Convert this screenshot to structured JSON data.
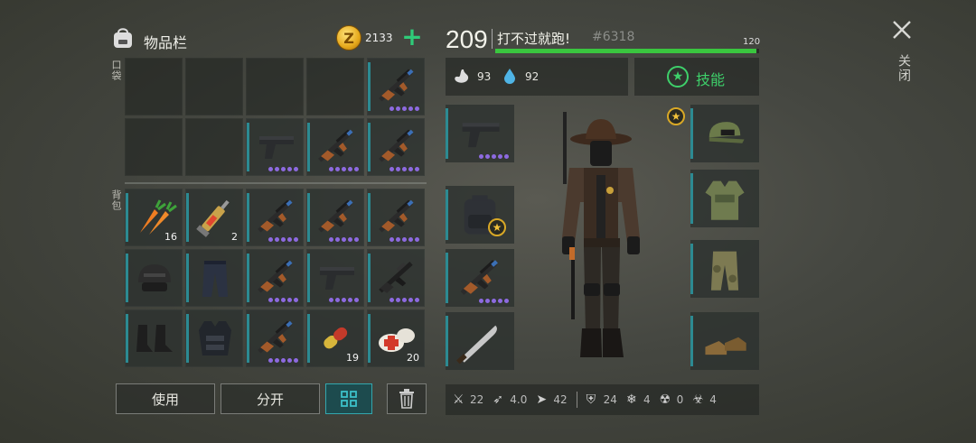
{
  "inventory": {
    "title": "物品栏",
    "coins": "2133",
    "coin_symbol": "Z",
    "add_label": "+",
    "pocket_label": "口袋",
    "backpack_label": "背包",
    "pocket": [
      {
        "item": "",
        "count": "",
        "dots": 0
      },
      {
        "item": "",
        "count": "",
        "dots": 0
      },
      {
        "item": "",
        "count": "",
        "dots": 0
      },
      {
        "item": "",
        "count": "",
        "dots": 0
      },
      {
        "item": "assault-rifle",
        "count": "",
        "dots": 5
      },
      {
        "item": "",
        "count": "",
        "dots": 0
      },
      {
        "item": "",
        "count": "",
        "dots": 0
      },
      {
        "item": "pistol",
        "count": "",
        "dots": 5
      },
      {
        "item": "assault-rifle",
        "count": "",
        "dots": 5
      },
      {
        "item": "assault-rifle",
        "count": "",
        "dots": 5
      }
    ],
    "backpack": [
      {
        "item": "carrots",
        "count": "16",
        "dots": 0
      },
      {
        "item": "syringe",
        "count": "2",
        "dots": 0
      },
      {
        "item": "assault-rifle",
        "count": "",
        "dots": 5
      },
      {
        "item": "assault-rifle",
        "count": "",
        "dots": 5
      },
      {
        "item": "assault-rifle",
        "count": "",
        "dots": 5
      },
      {
        "item": "helmet",
        "count": "",
        "dots": 0
      },
      {
        "item": "tactical-pants",
        "count": "",
        "dots": 0
      },
      {
        "item": "assault-rifle",
        "count": "",
        "dots": 5
      },
      {
        "item": "pistol",
        "count": "",
        "dots": 5
      },
      {
        "item": "rifle-dark",
        "count": "",
        "dots": 5
      },
      {
        "item": "boots",
        "count": "",
        "dots": 0
      },
      {
        "item": "armor-vest",
        "count": "",
        "dots": 0
      },
      {
        "item": "assault-rifle",
        "count": "",
        "dots": 5
      },
      {
        "item": "pills",
        "count": "19",
        "dots": 0
      },
      {
        "item": "bandage",
        "count": "20",
        "dots": 0
      }
    ],
    "buttons": {
      "use": "使用",
      "split": "分开"
    }
  },
  "player": {
    "level": "209",
    "name": "打不过就跑!",
    "id": "#6318",
    "xp_max": "120",
    "xp_fraction": 0.99,
    "hunger": "93",
    "thirst": "92",
    "skills_label": "技能"
  },
  "equipment": {
    "left": [
      "pistol",
      "backpack",
      "assault-rifle",
      "machete"
    ],
    "right": [
      "cap",
      "camo-jacket",
      "camo-pants",
      "shoes"
    ]
  },
  "stats": [
    {
      "icon": "melee-icon",
      "value": "22"
    },
    {
      "icon": "attack-speed-icon",
      "value": "4.0"
    },
    {
      "icon": "speed-icon",
      "value": "42"
    },
    {
      "icon": "armor-icon",
      "value": "24"
    },
    {
      "icon": "cold-icon",
      "value": "4"
    },
    {
      "icon": "radiation-icon",
      "value": "0"
    },
    {
      "icon": "toxic-icon",
      "value": "4"
    }
  ],
  "close_label": "关闭",
  "colors": {
    "accent_green": "#3ac63f",
    "tick_teal": "#2c8a92",
    "dot_purple": "#8d6ae0"
  }
}
